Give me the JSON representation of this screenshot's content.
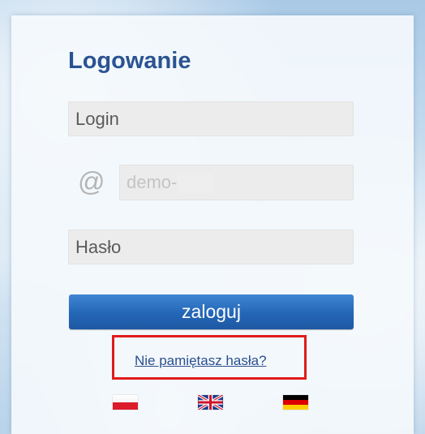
{
  "form": {
    "title": "Logowanie",
    "login_placeholder": "Login",
    "at_symbol": "@",
    "domain_value": "demo-",
    "password_placeholder": "Hasło",
    "submit_label": "zaloguj",
    "forgot_link": "Nie pamiętasz hasła?"
  },
  "languages": [
    {
      "code": "pl",
      "icon": "flag-poland-icon"
    },
    {
      "code": "en",
      "icon": "flag-uk-icon"
    },
    {
      "code": "de",
      "icon": "flag-germany-icon"
    }
  ],
  "colors": {
    "title": "#2a5392",
    "button": "#2466b6",
    "link": "#2a4f8e",
    "highlight_border": "#e01b1b"
  }
}
